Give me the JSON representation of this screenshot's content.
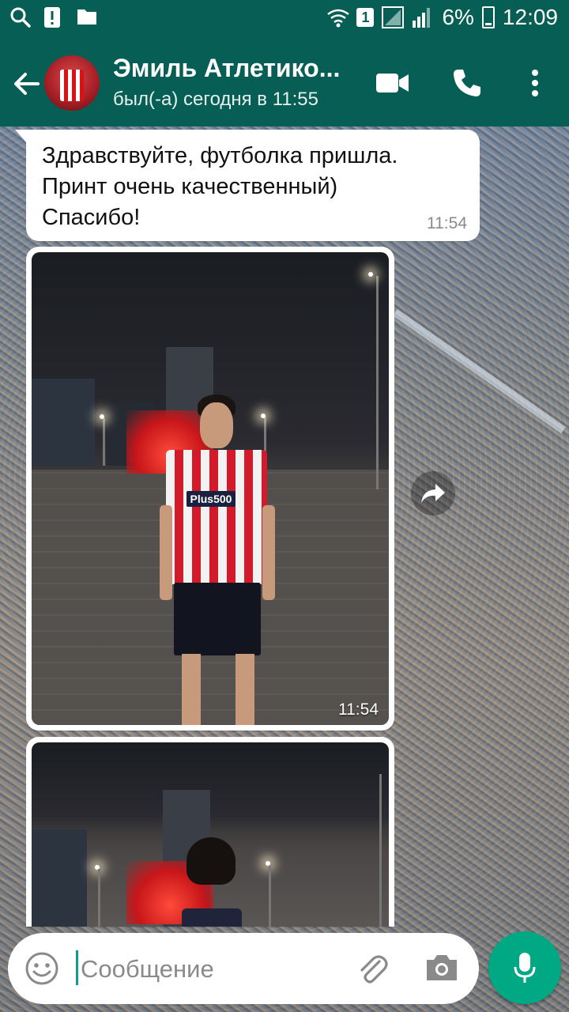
{
  "status_bar": {
    "sim_label": "1",
    "battery": "6%",
    "time": "12:09"
  },
  "header": {
    "contact_name": "Эмиль Атлетико...",
    "last_seen": "был(-а) сегодня в 11:55"
  },
  "messages": [
    {
      "type": "text",
      "text": "Здравствуйте, футболка пришла.\nПринт очень качественный)\nСпасибо!",
      "time": "11:54"
    },
    {
      "type": "image",
      "shirt_sponsor": "Plus500",
      "time": "11:54"
    },
    {
      "type": "image",
      "time": ""
    }
  ],
  "composer": {
    "placeholder": "Сообщение"
  },
  "colors": {
    "header": "#075e54",
    "accent": "#00a884",
    "bubble": "#ffffff"
  }
}
